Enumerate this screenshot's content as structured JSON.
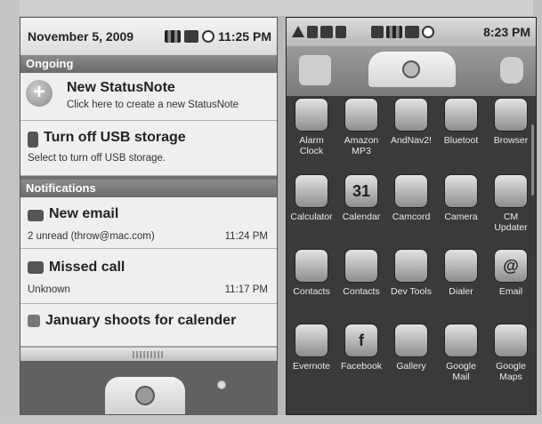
{
  "left": {
    "status": {
      "date": "November 5, 2009",
      "time": "11:25 PM"
    },
    "sections": {
      "ongoing": "Ongoing",
      "notifications": "Notifications"
    },
    "items": [
      {
        "title": "New StatusNote",
        "sub": "Click here to create a new StatusNote"
      },
      {
        "title": "Turn off USB storage",
        "sub": "Select to turn off USB storage."
      },
      {
        "title": "New email",
        "sub": "2 unread (throw@mac.com)",
        "time": "11:24 PM"
      },
      {
        "title": "Missed call",
        "sub": "Unknown",
        "time": "11:17 PM"
      },
      {
        "title": "January shoots for calender"
      }
    ]
  },
  "right": {
    "status": {
      "time": "8:23 PM"
    },
    "apps": [
      {
        "name": "Alarm Clock",
        "icon": "alarm-clock-icon"
      },
      {
        "name": "Amazon MP3",
        "icon": "amazon-mp3-icon"
      },
      {
        "name": "AndNav2!",
        "icon": "andnav-icon"
      },
      {
        "name": "Bluetoot",
        "icon": "bluetooth-icon"
      },
      {
        "name": "Browser",
        "icon": "globe-icon"
      },
      {
        "name": "Calculator",
        "icon": "calculator-icon"
      },
      {
        "name": "Calendar",
        "icon": "calendar-icon",
        "glyph": "31"
      },
      {
        "name": "Camcord",
        "icon": "camcorder-icon"
      },
      {
        "name": "Camera",
        "icon": "camera-icon"
      },
      {
        "name": "CM Updater",
        "icon": "cm-updater-icon"
      },
      {
        "name": "Contacts",
        "icon": "contacts-icon"
      },
      {
        "name": "Contacts",
        "icon": "contacts-grid-icon"
      },
      {
        "name": "Dev Tools",
        "icon": "gear-icon"
      },
      {
        "name": "Dialer",
        "icon": "phone-icon"
      },
      {
        "name": "Email",
        "icon": "email-icon",
        "glyph": "@"
      },
      {
        "name": "Evernote",
        "icon": "evernote-icon"
      },
      {
        "name": "Facebook",
        "icon": "facebook-icon",
        "glyph": "f"
      },
      {
        "name": "Gallery",
        "icon": "gallery-icon"
      },
      {
        "name": "Google Mail",
        "icon": "gmail-icon"
      },
      {
        "name": "Google Maps",
        "icon": "maps-icon"
      }
    ]
  }
}
